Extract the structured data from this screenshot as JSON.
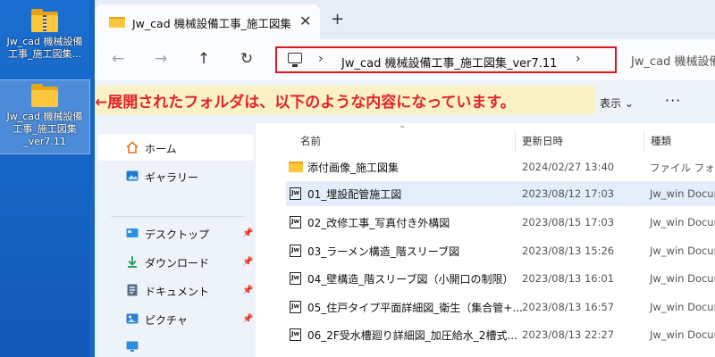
{
  "desktop": {
    "icons": [
      {
        "label": "Jw_cad 機械設備\n工事_施工図集...",
        "type": "zip-folder"
      },
      {
        "label": "Jw_cad 機械設備\n工事_施工図集\n_ver7.11",
        "type": "folder"
      }
    ]
  },
  "window": {
    "tab_title": "Jw_cad 機械設備工事_施工図集",
    "close_glyph": "✕",
    "add_glyph": "+",
    "address": {
      "crumb_main": "Jw_cad 機械設備工事_施工図集_ver7.11",
      "crumb_next": "Jw_cad 機械設備"
    },
    "nav": {
      "back": "←",
      "forward": "→",
      "up": "↑",
      "refresh": "↻"
    },
    "toolbar": {
      "view_label": "表示 ⌄",
      "more": "···"
    }
  },
  "callout": {
    "text": "←展開されたフォルダは、以下のような内容になっています。"
  },
  "sidebar": {
    "items": [
      {
        "label": "ホーム",
        "icon": "home-icon"
      },
      {
        "label": "ギャラリー",
        "icon": "gallery-icon"
      },
      {
        "label": "デスクトップ",
        "icon": "desktop-icon",
        "pinned": true
      },
      {
        "label": "ダウンロード",
        "icon": "download-icon",
        "pinned": true
      },
      {
        "label": "ドキュメント",
        "icon": "document-icon",
        "pinned": true
      },
      {
        "label": "ピクチャ",
        "icon": "pictures-icon",
        "pinned": true
      }
    ]
  },
  "columns": {
    "name": "名前",
    "date": "更新日時",
    "type": "種類"
  },
  "files": [
    {
      "name": "添付画像_施工図集",
      "date": "2024/02/27 13:40",
      "type": "ファイル フォルダー",
      "kind": "folder"
    },
    {
      "name": "01_埋設配管施工図",
      "date": "2023/08/12 17:03",
      "type": "Jw_win Document",
      "kind": "jw",
      "selected": true
    },
    {
      "name": "02_改修工事_写真付き外構図",
      "date": "2023/08/15 17:03",
      "type": "Jw_win Document",
      "kind": "jw"
    },
    {
      "name": "03_ラーメン構造_階スリーブ図",
      "date": "2023/08/13 15:26",
      "type": "Jw_win Document",
      "kind": "jw"
    },
    {
      "name": "04_壁構造_階スリーブ図（小開口の制限）",
      "date": "2023/08/13 16:01",
      "type": "Jw_win Document",
      "kind": "jw"
    },
    {
      "name": "05_住戸タイプ平面詳細図_衛生（集合管+...",
      "date": "2023/08/13 16:57",
      "type": "Jw_win Document",
      "kind": "jw"
    },
    {
      "name": "06_2F受水槽廻り詳細図_加圧給水_2槽式...",
      "date": "2023/08/13 22:27",
      "type": "Jw_win Document",
      "kind": "jw"
    }
  ]
}
